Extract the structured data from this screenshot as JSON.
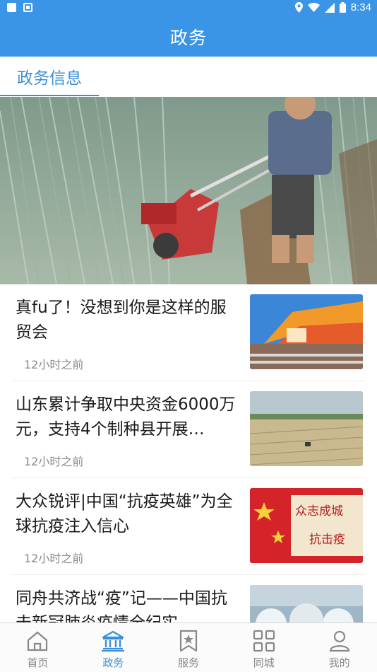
{
  "status_bar": {
    "time": "8:34"
  },
  "header": {
    "title": "政务"
  },
  "section_tab": {
    "label": "政务信息"
  },
  "news": [
    {
      "title": "真fu了！没想到你是这样的服贸会",
      "time": "12小时之前"
    },
    {
      "title": "山东累计争取中央资金6000万元，支持4个制种县开展…",
      "time": "12小时之前"
    },
    {
      "title": "大众锐评|中国“抗疫英雄”为全球抗疫注入信心",
      "time": "12小时之前"
    },
    {
      "title": "同舟共济战“疫”记——中国抗击新冠肺炎疫情全纪实",
      "time": ""
    }
  ],
  "thumbnail_texts": {
    "banner_line1": "众志成城",
    "banner_line2": "抗击疫"
  },
  "bottom_nav": [
    {
      "label": "首页",
      "icon": "home-icon",
      "active": false
    },
    {
      "label": "政务",
      "icon": "government-building-icon",
      "active": true
    },
    {
      "label": "服务",
      "icon": "bookmark-star-icon",
      "active": false
    },
    {
      "label": "同城",
      "icon": "grid-icon",
      "active": false
    },
    {
      "label": "我的",
      "icon": "user-icon",
      "active": false
    }
  ],
  "colors": {
    "primary": "#3a95e6",
    "tab_active": "#3a8fd8",
    "nav_inactive": "#888888"
  }
}
